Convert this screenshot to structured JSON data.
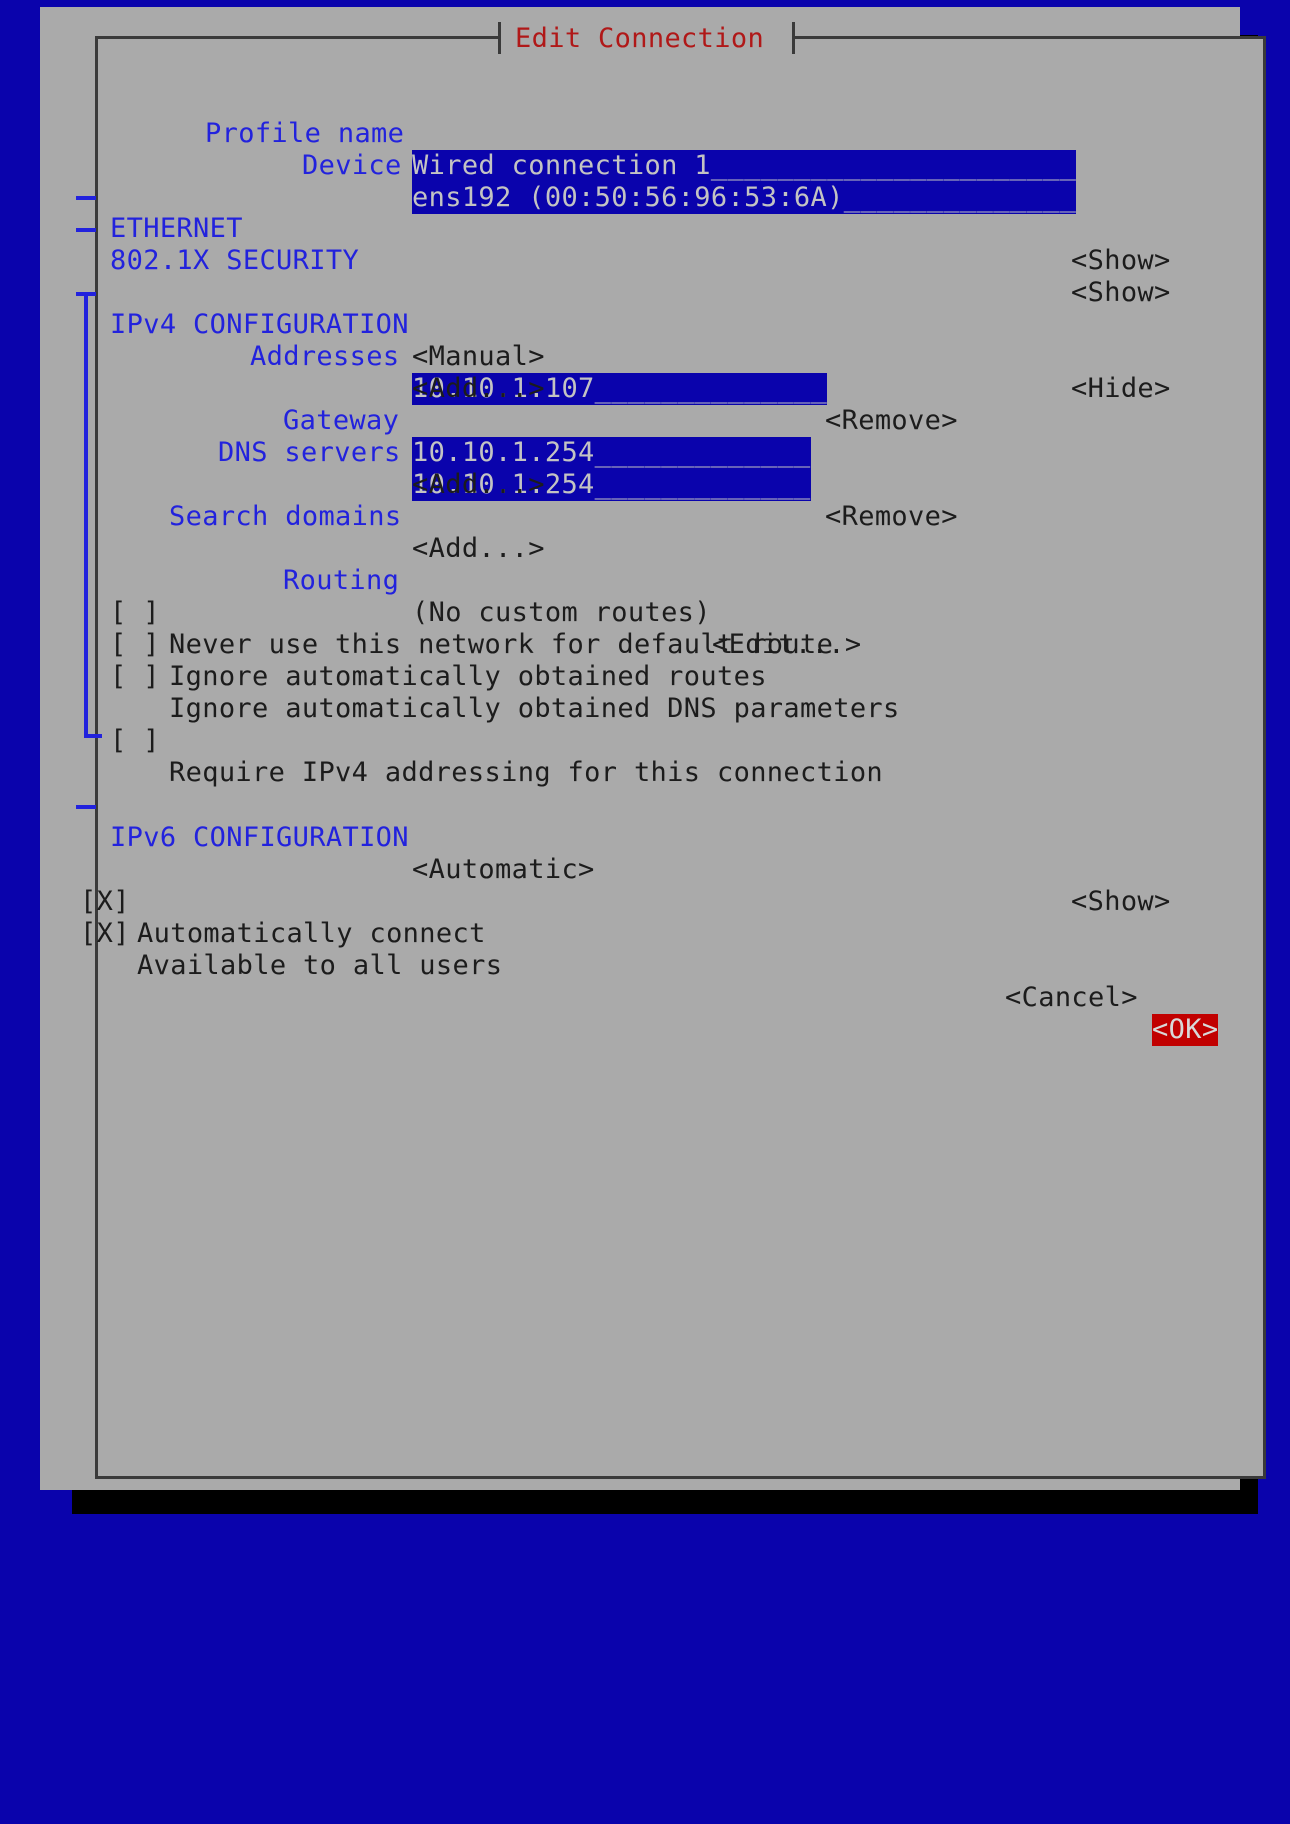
{
  "window": {
    "title": "Edit Connection",
    "app": "nmtui",
    "colors": {
      "terminal_background": "#0a03ac",
      "dialog_background": "#aaaaaa",
      "border": "#3a3a3a",
      "title_text": "#b01818",
      "label_blue": "#2222dd",
      "text_black": "#1c1c1c",
      "field_background": "#0a03ac",
      "field_text": "#c3c3c3",
      "focus_background": "#c10000",
      "focus_text": "#d8d8d8"
    }
  },
  "form": {
    "profile_name": {
      "label": "Profile name",
      "value": "Wired connection 1",
      "filler": "______________________"
    },
    "device": {
      "label": "Device",
      "value": "ens192 (00:50:56:96:53:6A)",
      "filler": "______________"
    }
  },
  "sections": {
    "ethernet": {
      "title": "ETHERNET",
      "toggle": "<Show>",
      "marker": "─"
    },
    "security": {
      "title": "802.1X SECURITY",
      "toggle": "<Show>",
      "marker": "─"
    },
    "ipv4": {
      "title": "IPv4 CONFIGURATION",
      "method": "<Manual>",
      "toggle": "<Hide>",
      "marker": "┬"
    },
    "ipv6": {
      "title": "IPv6 CONFIGURATION",
      "method": "<Automatic>",
      "toggle": "<Show>",
      "marker": "─"
    }
  },
  "ipv4_fields": {
    "addresses": {
      "label": "Addresses",
      "value": "10.10.1.107",
      "filler": "______________",
      "remove": "<Remove>",
      "add": "<Add...>"
    },
    "gateway": {
      "label": "Gateway",
      "value": "10.10.1.254",
      "filler": "_____________"
    },
    "dns_servers": {
      "label": "DNS servers",
      "value": "10.10.1.254",
      "filler": "_____________",
      "remove": "<Remove>",
      "add": "<Add...>"
    },
    "search_domains": {
      "label": "Search domains",
      "add": "<Add...>"
    },
    "routing": {
      "label": "Routing",
      "status": "(No custom routes)",
      "edit": "<Edit...>"
    }
  },
  "ipv4_checkboxes": [
    {
      "box": "[ ]",
      "checked": false,
      "label": "Never use this network for default route"
    },
    {
      "box": "[ ]",
      "checked": false,
      "label": "Ignore automatically obtained routes"
    },
    {
      "box": "[ ]",
      "checked": false,
      "label": "Ignore automatically obtained DNS parameters"
    },
    {
      "box": "[ ]",
      "checked": false,
      "label": "Require IPv4 addressing for this connection"
    }
  ],
  "global_checkboxes": [
    {
      "box": "[X]",
      "checked": true,
      "label": "Automatically connect"
    },
    {
      "box": "[X]",
      "checked": true,
      "label": "Available to all users"
    }
  ],
  "buttons": {
    "cancel": "<Cancel>",
    "ok": "<OK>"
  }
}
